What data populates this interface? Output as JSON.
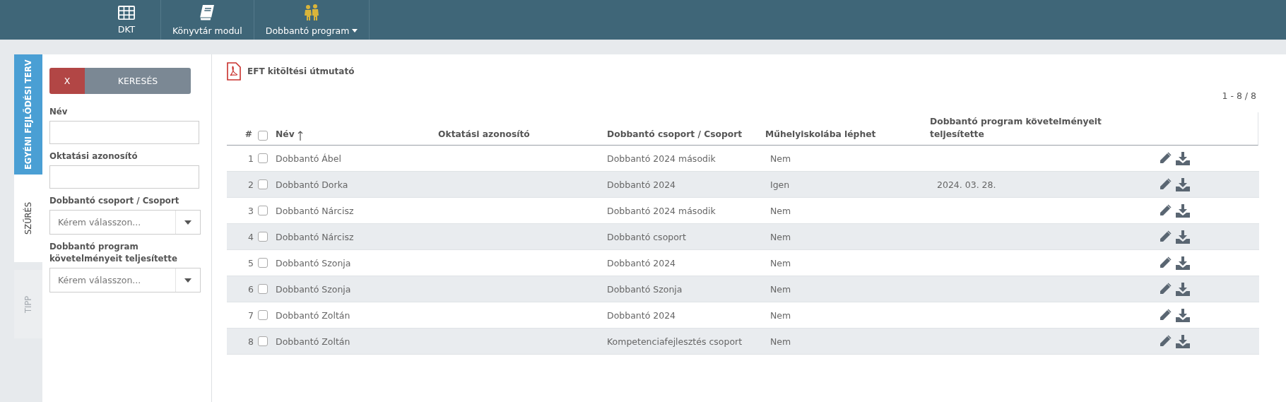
{
  "nav": [
    {
      "label": "DKT",
      "kind": "grid",
      "has_menu": false
    },
    {
      "label": "Könyvtár modul",
      "kind": "book",
      "has_menu": false
    },
    {
      "label": "Dobbantó program",
      "kind": "children",
      "has_menu": true
    }
  ],
  "side_tabs": [
    {
      "label": "EGYÉNI FEJLŐDÉSI TERV",
      "kind": "accent",
      "selected": false,
      "disabled": false
    },
    {
      "label": "SZŰRÉS",
      "kind": "plain",
      "selected": true,
      "disabled": false
    },
    {
      "label": "TIPP",
      "kind": "plain",
      "selected": false,
      "disabled": true
    }
  ],
  "filter": {
    "clear_button": "X",
    "search_button": "KERESÉS",
    "fields": [
      {
        "label": "Név",
        "kind": "text"
      },
      {
        "label": "Oktatási azonosító",
        "kind": "text"
      },
      {
        "label": "Dobbantó csoport / Csoport",
        "kind": "select",
        "placeholder": "Kérem válasszon..."
      },
      {
        "label": "Dobbantó program követelményeit teljesítette",
        "kind": "select",
        "placeholder": "Kérem válasszon..."
      }
    ]
  },
  "guide_link": "EFT kitöltési útmutató",
  "pagination": "1 - 8 / 8",
  "table": {
    "select_all_checked": false,
    "columns": [
      {
        "label": "#",
        "sorted": false
      },
      {
        "label": "Név",
        "sorted": true
      },
      {
        "label": "Oktatási azonosító",
        "sorted": false
      },
      {
        "label": "Dobbantó csoport / Csoport",
        "sorted": false
      },
      {
        "label": "Műhelyiskolába léphet",
        "sorted": false
      },
      {
        "label": "Dobbantó program követelményeit teljesítette",
        "sorted": false
      }
    ],
    "rows": [
      {
        "number": "1",
        "checked": false,
        "name": "Dobbantó Ábel",
        "group": "Dobbantó 2024 második",
        "workshop": "Nem"
      },
      {
        "number": "2",
        "checked": false,
        "name": "Dobbantó Dorka",
        "group": "Dobbantó 2024",
        "workshop": "Igen",
        "completed": "2024. 03. 28."
      },
      {
        "number": "3",
        "checked": false,
        "name": "Dobbantó Nárcisz",
        "group": "Dobbantó 2024 második",
        "workshop": "Nem"
      },
      {
        "number": "4",
        "checked": false,
        "name": "Dobbantó Nárcisz",
        "group": "Dobbantó csoport",
        "workshop": "Nem"
      },
      {
        "number": "5",
        "checked": false,
        "name": "Dobbantó Szonja",
        "group": "Dobbantó 2024",
        "workshop": "Nem"
      },
      {
        "number": "6",
        "checked": false,
        "name": "Dobbantó Szonja",
        "group": "Dobbantó Szonja",
        "workshop": "Nem"
      },
      {
        "number": "7",
        "checked": false,
        "name": "Dobbantó Zoltán",
        "group": "Dobbantó 2024",
        "workshop": "Nem"
      },
      {
        "number": "8",
        "checked": false,
        "name": "Dobbantó Zoltán",
        "group": "Kompetenciafejlesztés csoport",
        "workshop": "Nem"
      }
    ]
  }
}
